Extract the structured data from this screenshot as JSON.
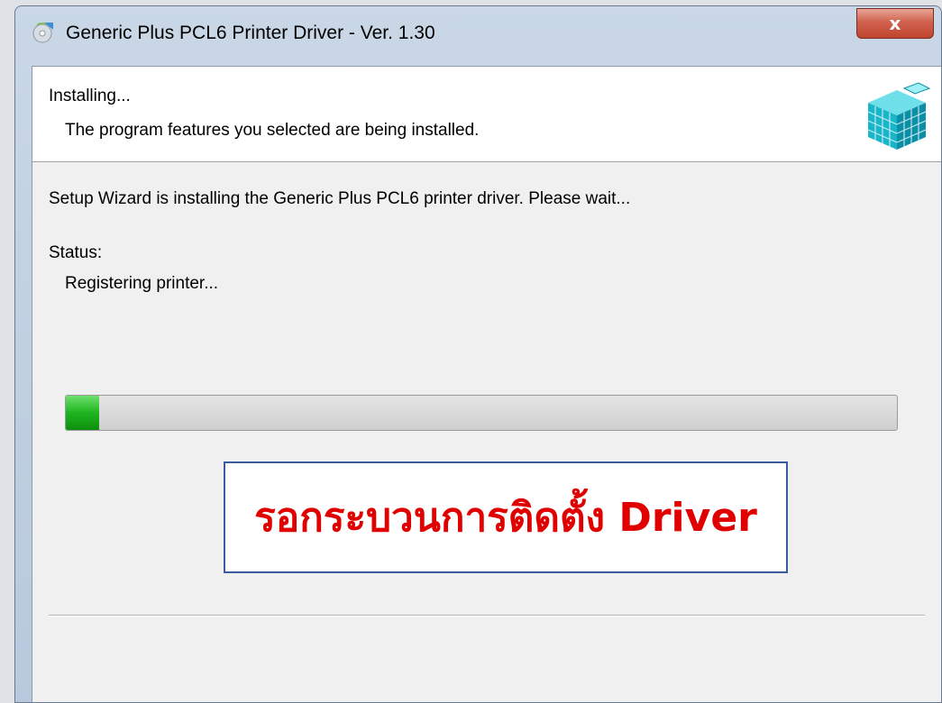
{
  "window": {
    "title": "Generic Plus PCL6 Printer Driver - Ver. 1.30",
    "close_glyph": "x",
    "app_icon": "setup-cd-icon"
  },
  "header": {
    "title": "Installing...",
    "subtitle": "The program features you selected are being installed.",
    "icon": "installer-package-icon"
  },
  "body": {
    "message": "Setup Wizard is installing the Generic Plus PCL6 printer driver. Please wait...",
    "status_label": "Status:",
    "status_value": "Registering printer..."
  },
  "progress": {
    "value_percent": 4,
    "fill_color": "#22b522"
  },
  "callout": {
    "text": "รอกระบวนการติดตั้ง Driver",
    "text_color": "#e00000",
    "border_color": "#3a5ba0"
  }
}
